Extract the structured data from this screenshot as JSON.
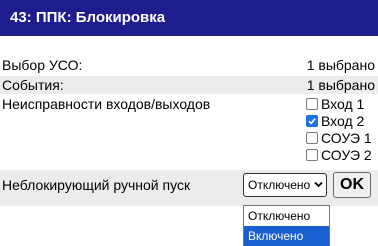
{
  "header": {
    "title": "43: ППК: Блокировка"
  },
  "rows": [
    {
      "label": "Выбор УСО:",
      "value": "1 выбрано"
    },
    {
      "label": "События:",
      "value": "1 выбрано"
    }
  ],
  "io_faults": {
    "label": "Неисправности входов/выходов",
    "options": [
      {
        "label": "Вход 1",
        "checked": false
      },
      {
        "label": "Вход 2",
        "checked": true
      },
      {
        "label": "СОУЭ 1",
        "checked": false
      },
      {
        "label": "СОУЭ 2",
        "checked": false
      }
    ]
  },
  "manual_start": {
    "label": "Неблокирующий ручной пуск",
    "selected": "Отключено",
    "ok_label": "OK",
    "options": [
      "Отключено",
      "Включено"
    ],
    "highlighted": "Включено"
  },
  "colors": {
    "header_bg": "#1e1d8e",
    "checkbox_checked": "#1a73e8",
    "option_highlight": "#1a5fd0"
  }
}
